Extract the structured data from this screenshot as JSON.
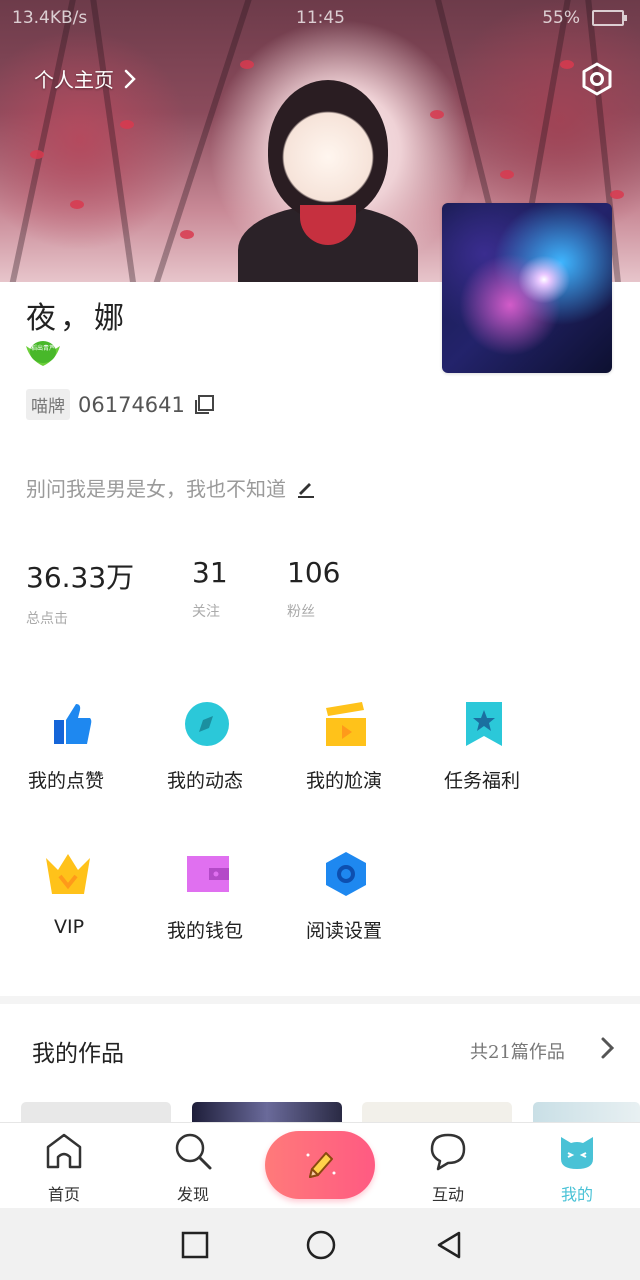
{
  "status_bar": {
    "net_speed": "13.4KB/s",
    "time": "11:45",
    "battery": "55%"
  },
  "header": {
    "home_link": "个人主页"
  },
  "profile": {
    "username": "夜，娜",
    "badge_text": "稻出青芦",
    "id_tag": "喵牌",
    "id_number": "06174641",
    "bio": "别问我是男是女，我也不知道"
  },
  "stats": [
    {
      "value": "36.33万",
      "label": "总点击"
    },
    {
      "value": "31",
      "label": "关注"
    },
    {
      "value": "106",
      "label": "粉丝"
    }
  ],
  "menu": [
    {
      "label": "我的点赞",
      "icon": "thumbs-up-icon",
      "color": "#1e88f0"
    },
    {
      "label": "我的动态",
      "icon": "compass-icon",
      "color": "#2bc8d9"
    },
    {
      "label": "我的尬演",
      "icon": "clapperboard-icon",
      "color": "#ffc21a"
    },
    {
      "label": "任务福利",
      "icon": "bookmark-star-icon",
      "color": "#2bc8d9"
    },
    {
      "label": "VIP",
      "icon": "crown-icon",
      "color": "#ffc21a"
    },
    {
      "label": "我的钱包",
      "icon": "wallet-icon",
      "color": "#e070f0"
    },
    {
      "label": "阅读设置",
      "icon": "hexagon-icon",
      "color": "#1e88f0"
    }
  ],
  "works": {
    "title": "我的作品",
    "count_text": "共21篇作品"
  },
  "bottom_nav": [
    {
      "label": "首页",
      "icon": "home-icon"
    },
    {
      "label": "发现",
      "icon": "search-icon"
    },
    {
      "label": "",
      "icon": "pencil-icon"
    },
    {
      "label": "互动",
      "icon": "chat-bubble-icon"
    },
    {
      "label": "我的",
      "icon": "cat-face-icon",
      "active": true
    }
  ],
  "colors": {
    "accent": "#49c2d6",
    "fab_start": "#ff7a7a",
    "fab_end": "#ff5a82"
  }
}
